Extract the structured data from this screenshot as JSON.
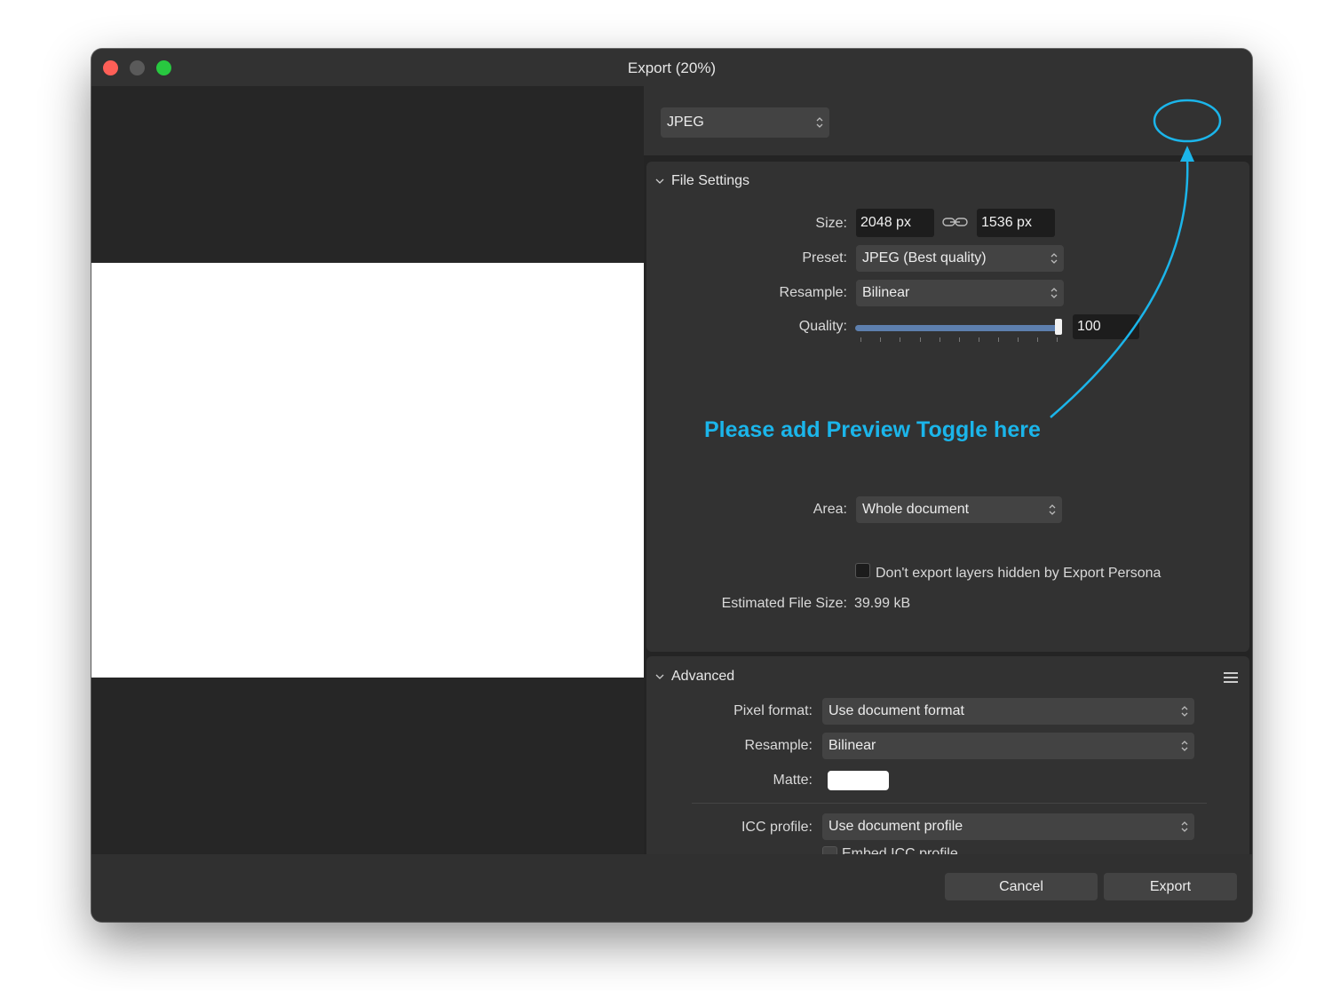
{
  "window": {
    "title": "Export (20%)"
  },
  "format": {
    "selected": "JPEG"
  },
  "file_settings": {
    "title": "File Settings",
    "size_label": "Size:",
    "width": "2048 px",
    "height": "1536 px",
    "preset_label": "Preset:",
    "preset": "JPEG (Best quality)",
    "resample_label": "Resample:",
    "resample": "Bilinear",
    "quality_label": "Quality:",
    "quality_value": "100",
    "quality_level": 100,
    "area_label": "Area:",
    "area": "Whole document",
    "hidden_layers_label": "Don't export layers hidden by Export Persona",
    "estimated_label": "Estimated File Size:",
    "estimated_value": "39.99 kB"
  },
  "advanced": {
    "title": "Advanced",
    "pixel_format_label": "Pixel format:",
    "pixel_format": "Use document format",
    "resample_label": "Resample:",
    "resample": "Bilinear",
    "matte_label": "Matte:",
    "matte_color": "#ffffff",
    "icc_label": "ICC profile:",
    "icc": "Use document profile",
    "embed_icc_label": "Embed ICC profile"
  },
  "buttons": {
    "cancel": "Cancel",
    "export": "Export"
  },
  "annotation": {
    "text": "Please add Preview Toggle here",
    "color": "#1bb5ea"
  },
  "icons": [
    "chevron-updown-icon",
    "link-icon",
    "disclosure-icon",
    "hamburger-menu-icon"
  ]
}
